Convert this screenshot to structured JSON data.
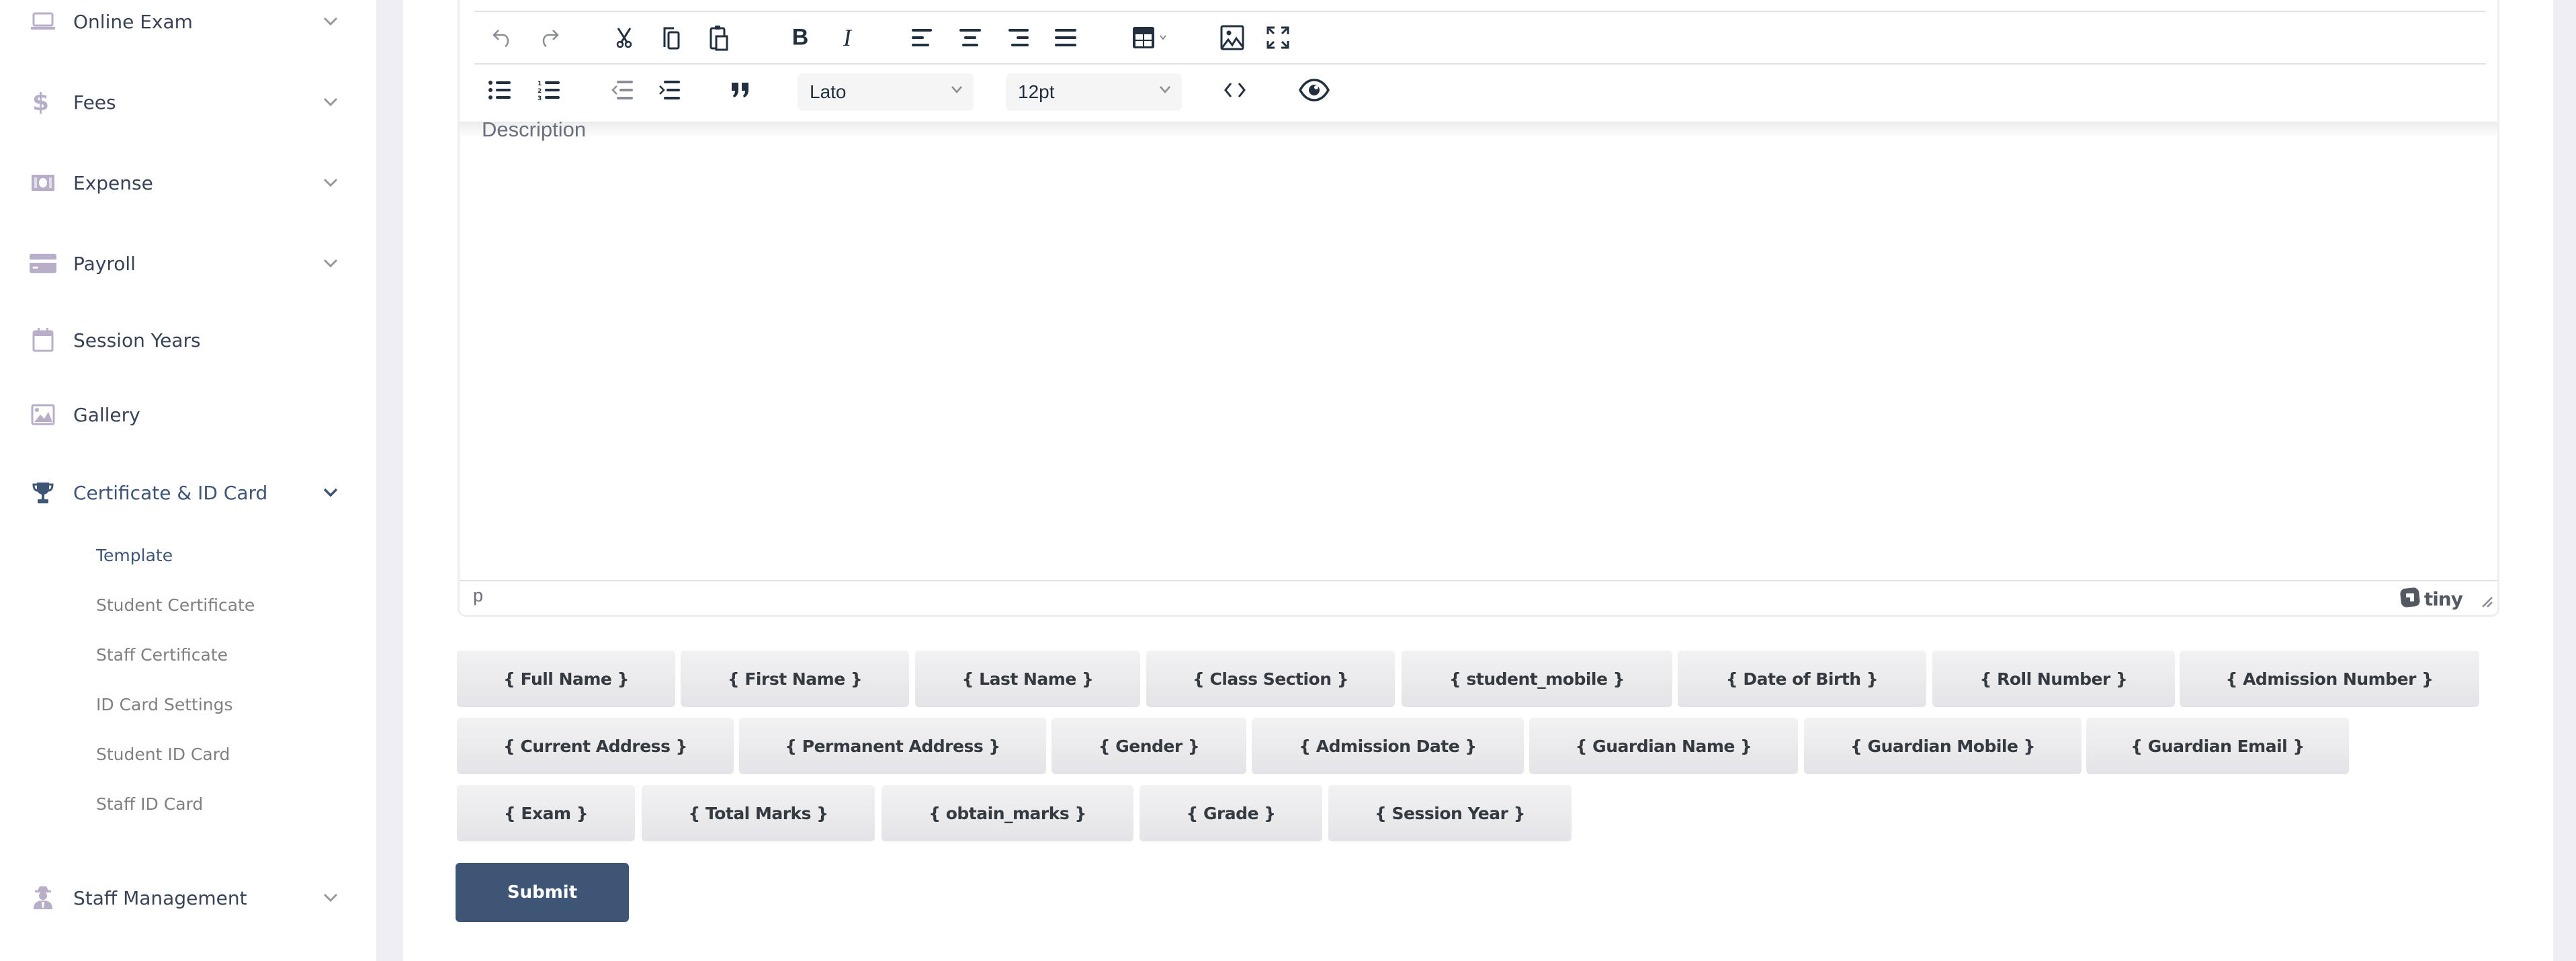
{
  "sidebar": {
    "items": [
      {
        "label": "Online Exam",
        "icon": "laptop-icon",
        "has_chevron": true
      },
      {
        "label": "Fees",
        "icon": "dollar-icon",
        "has_chevron": true
      },
      {
        "label": "Expense",
        "icon": "money-bill-icon",
        "has_chevron": true
      },
      {
        "label": "Payroll",
        "icon": "credit-card-icon",
        "has_chevron": true
      },
      {
        "label": "Session Years",
        "icon": "calendar-icon",
        "has_chevron": false
      },
      {
        "label": "Gallery",
        "icon": "image-icon",
        "has_chevron": false
      },
      {
        "label": "Certificate & ID Card",
        "icon": "trophy-icon",
        "has_chevron": true,
        "active": true
      },
      {
        "label": "Staff Management",
        "icon": "user-secret-icon",
        "has_chevron": true
      }
    ],
    "sub_items": [
      {
        "label": "Template",
        "active": true
      },
      {
        "label": "Student Certificate"
      },
      {
        "label": "Staff Certificate"
      },
      {
        "label": "ID Card Settings"
      },
      {
        "label": "Student ID Card"
      },
      {
        "label": "Staff ID Card"
      }
    ]
  },
  "editor": {
    "toolbar_row1": [
      "undo-icon",
      "redo-icon",
      "cut-icon",
      "copy-icon",
      "paste-icon",
      "bold-icon",
      "italic-icon",
      "align-left-icon",
      "align-center-icon",
      "align-right-icon",
      "align-justify-icon",
      "table-icon",
      "image-icon",
      "fullscreen-icon"
    ],
    "toolbar_row2": [
      "bullet-list-icon",
      "numbered-list-icon",
      "outdent-icon",
      "indent-icon",
      "blockquote-icon",
      "code-icon",
      "preview-icon"
    ],
    "font_family": "Lato",
    "font_size": "12pt",
    "placeholder": "Description",
    "path": "p",
    "brand": "tiny"
  },
  "placeholders": {
    "row1": [
      "{ Full Name }",
      "{ First Name }",
      "{ Last Name }",
      "{ Class Section }",
      "{ student_mobile }",
      "{ Date of Birth }",
      "{ Roll Number }",
      "{ Admission Number }"
    ],
    "row2": [
      "{ Current Address }",
      "{ Permanent Address }",
      "{ Gender }",
      "{ Admission Date }",
      "{ Guardian Name }",
      "{ Guardian Mobile }",
      "{ Guardian Email }"
    ],
    "row3": [
      "{ Exam }",
      "{ Total Marks }",
      "{ obtain_marks }",
      "{ Grade }",
      "{ Session Year }"
    ]
  },
  "submit_label": "Submit",
  "colors": {
    "primary": "#3f5576",
    "sidebar_icon": "#b8aec8",
    "background": "#f0eef5"
  }
}
